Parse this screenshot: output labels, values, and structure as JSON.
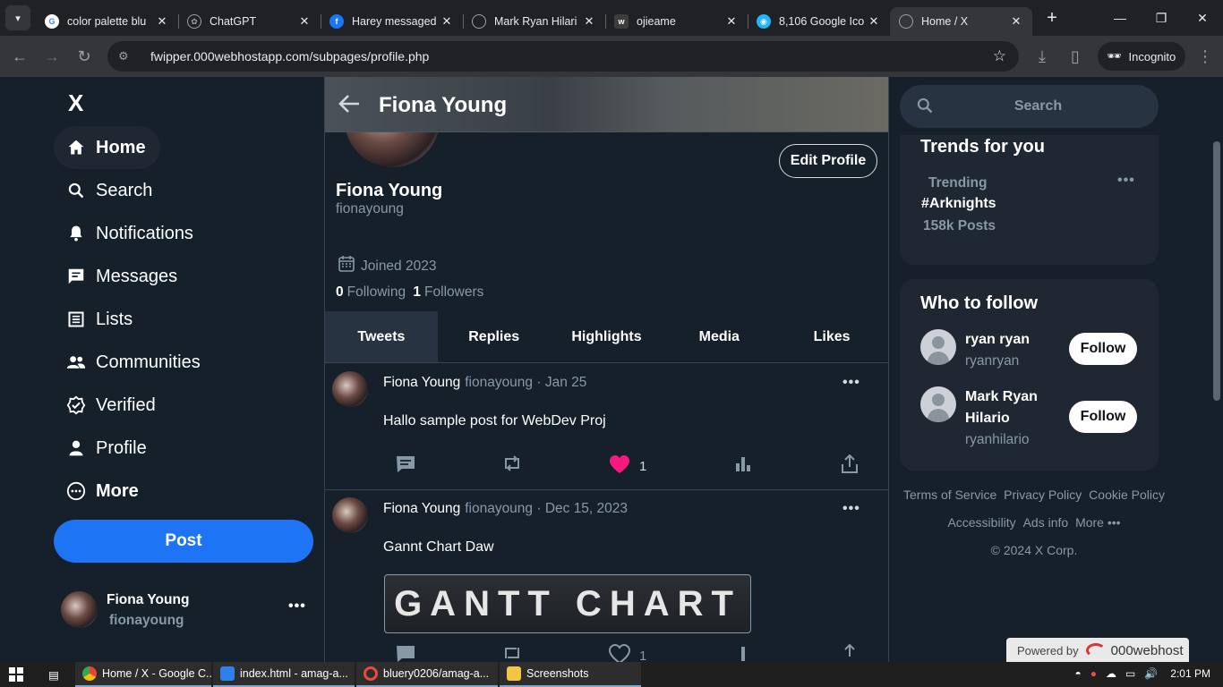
{
  "browser": {
    "tabs": [
      {
        "title": "color palette blu",
        "icon": "google-icon",
        "color": "#4285f4"
      },
      {
        "title": "ChatGPT",
        "icon": "chatgpt-icon",
        "color": "#10a37f"
      },
      {
        "title": "Harey messaged",
        "icon": "facebook-icon",
        "color": "#1877f2"
      },
      {
        "title": "Mark Ryan Hilari",
        "icon": "globe-icon",
        "color": "#9aa0a6"
      },
      {
        "title": "ojieame",
        "icon": "webflow-icon",
        "color": "#3d3d3d"
      },
      {
        "title": "8,106 Google Ico",
        "icon": "search-app-icon",
        "color": "#1fb6ff"
      },
      {
        "title": "Home / X",
        "icon": "globe-icon",
        "color": "#9aa0a6",
        "active": true
      }
    ],
    "url": "fwipper.000webhostapp.com/subpages/profile.php",
    "incognito_label": "Incognito"
  },
  "sidebar": {
    "logo": "X",
    "nav": [
      {
        "label": "Home",
        "icon": "home-icon",
        "active": true
      },
      {
        "label": "Search",
        "icon": "search-icon"
      },
      {
        "label": "Notifications",
        "icon": "bell-icon"
      },
      {
        "label": "Messages",
        "icon": "message-icon"
      },
      {
        "label": "Lists",
        "icon": "list-icon"
      },
      {
        "label": "Communities",
        "icon": "people-icon"
      },
      {
        "label": "Verified",
        "icon": "verified-icon"
      },
      {
        "label": "Profile",
        "icon": "person-icon"
      },
      {
        "label": "More",
        "icon": "more-circle-icon"
      }
    ],
    "post_label": "Post",
    "account": {
      "name": "Fiona Young",
      "handle": "fionayoung",
      "menu": "•••"
    }
  },
  "profile": {
    "header_name": "Fiona Young",
    "edit_label": "Edit Profile",
    "name": "Fiona Young",
    "handle": "fionayoung",
    "joined": "Joined 2023",
    "following_count": "0",
    "following_label": "Following",
    "followers_count": "1",
    "followers_label": "Followers",
    "tabs": [
      "Tweets",
      "Replies",
      "Highlights",
      "Media",
      "Likes"
    ],
    "active_tab": "Tweets"
  },
  "tweets": [
    {
      "name": "Fiona Young",
      "meta": "fionayoung · Jan 25",
      "text": "Hallo sample post for WebDev Proj",
      "likes": "1",
      "liked": true,
      "more": "•••"
    },
    {
      "name": "Fiona Young",
      "meta": "fionayoung · Dec 15, 2023",
      "text": "Gannt Chart Daw",
      "image_text": "GANTT CHART",
      "likes": "1",
      "liked": false,
      "more": "•••"
    }
  ],
  "right": {
    "search_placeholder": "Search",
    "trends_title": "Trends for you",
    "trend": {
      "label": "Trending",
      "tag": "#Arknights",
      "count": "158k Posts"
    },
    "wtf_title": "Who to follow",
    "suggestions": [
      {
        "name": "ryan ryan",
        "handle": "ryanryan",
        "button": "Follow"
      },
      {
        "name": "Mark Ryan Hilario",
        "handle": "ryanhilario",
        "button": "Follow"
      }
    ],
    "footer_links": [
      "Terms of Service",
      "Privacy Policy",
      "Cookie Policy",
      "Accessibility",
      "Ads info",
      "More •••"
    ],
    "copyright": "© 2024 X Corp."
  },
  "powered": {
    "prefix": "Powered by",
    "brand": "000webhost"
  },
  "taskbar": {
    "items": [
      {
        "label": "Home / X - Google C...",
        "color": "#4285f4"
      },
      {
        "label": "index.html - amag-a...",
        "color": "#2f80ed"
      },
      {
        "label": "bluery0206/amag-a...",
        "color": "#e74c3c"
      },
      {
        "label": "Screenshots",
        "color": "#f4c542"
      }
    ],
    "time": "2:01 PM"
  },
  "colors": {
    "accent": "#1d74f5",
    "like": "#f91880",
    "bg": "#15202b",
    "muted": "#8899a6"
  }
}
